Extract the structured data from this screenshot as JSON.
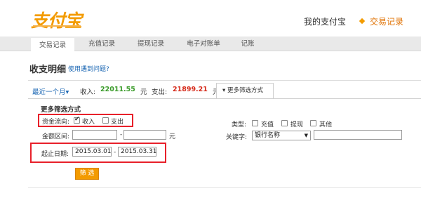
{
  "header": {
    "logo_text": "支付宝",
    "my_alipay": "我的支付宝",
    "current_section": "交易记录"
  },
  "subnav": {
    "tabs": [
      {
        "label": "交易记录",
        "active": true
      },
      {
        "label": "充值记录",
        "active": false
      },
      {
        "label": "提现记录",
        "active": false
      },
      {
        "label": "电子对账单",
        "active": false
      },
      {
        "label": "记账",
        "active": false
      }
    ]
  },
  "page": {
    "title": "收支明细",
    "help_link": "使用遇到问题?"
  },
  "summary": {
    "period": "最近一个月",
    "period_arrow": "▾",
    "income_label": "收入:",
    "income_value": "22011.55",
    "income_unit": "元",
    "expense_label": "支出:",
    "expense_value": "21899.21",
    "expense_unit": "元",
    "more_filters_toggle": "▾ 更多筛选方式"
  },
  "filters": {
    "title": "更多筛选方式",
    "direction_label": "资金流向:",
    "income_option": "收入",
    "income_checked": true,
    "expense_option": "支出",
    "expense_checked": false,
    "amount_label": "金额区间:",
    "amount_min": "",
    "amount_sep": "-",
    "amount_max": "",
    "amount_unit": "元",
    "date_label": "起止日期:",
    "date_start": "2015.03.01",
    "date_sep": "-",
    "date_end": "2015.03.31",
    "type_label": "类型:",
    "type_options": [
      {
        "label": "充值",
        "checked": false
      },
      {
        "label": "提现",
        "checked": false
      },
      {
        "label": "其他",
        "checked": false
      }
    ],
    "keyword_label": "关键字:",
    "keyword_select": "银行名称",
    "keyword_value": "",
    "submit_label": "筛 选"
  },
  "colors": {
    "accent": "#f39b00",
    "link": "#1a66b3",
    "income": "#3a9b2a",
    "expense": "#d62b1b",
    "highlight_box": "#e8202a"
  }
}
